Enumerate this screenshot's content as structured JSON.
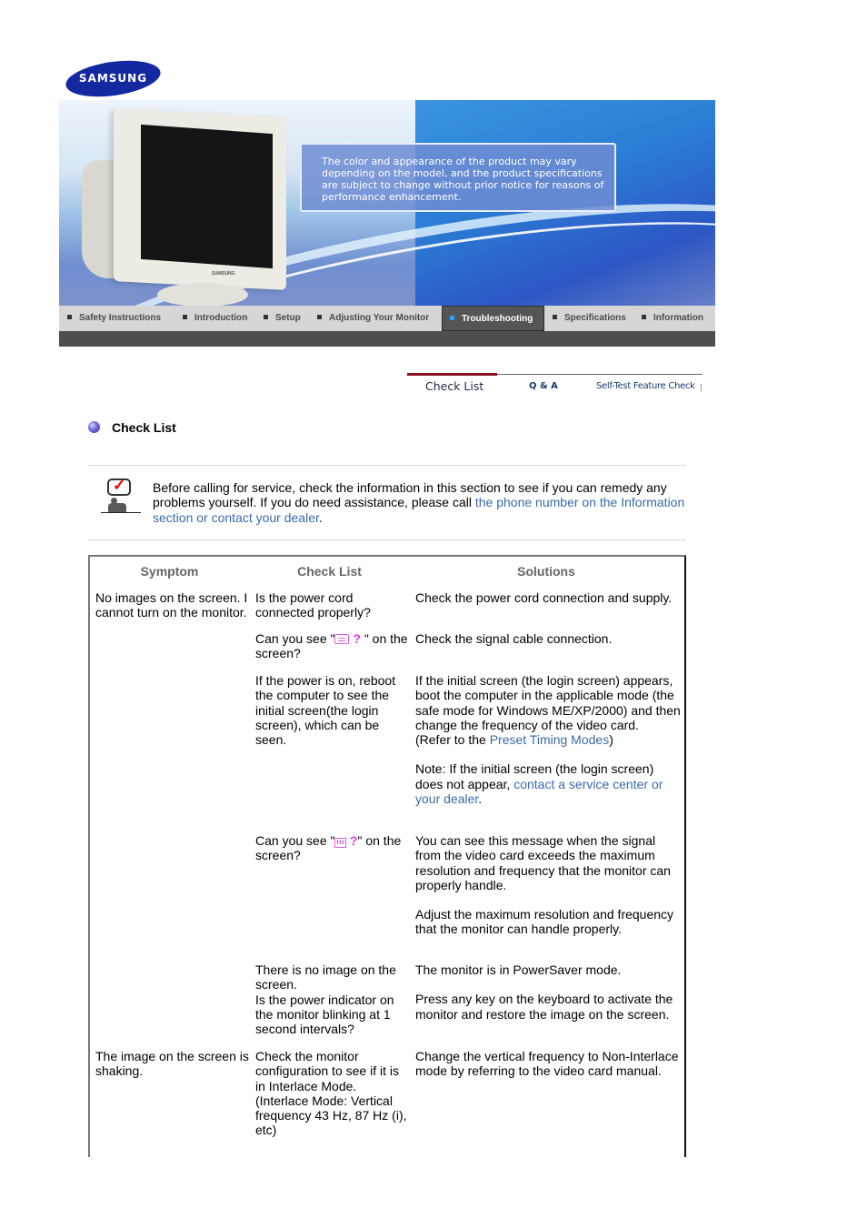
{
  "logo": {
    "text": "SAMSUNG"
  },
  "banner": {
    "notice": "The color and appearance of the product may vary depending on the model, and the product specifications are subject to change without prior notice for reasons of performance enhancement.",
    "monitor_brand": "SAMSUNG"
  },
  "nav": {
    "items": [
      {
        "label": "Safety Instructions",
        "active": false
      },
      {
        "label": "Introduction",
        "active": false
      },
      {
        "label": "Setup",
        "active": false
      },
      {
        "label": "Adjusting Your Monitor",
        "active": false
      },
      {
        "label": "Troubleshooting",
        "active": true
      },
      {
        "label": "Specifications",
        "active": false
      },
      {
        "label": "Information",
        "active": false
      }
    ],
    "active_color": "#2ba0ff"
  },
  "subtabs": {
    "items": [
      {
        "label": "Check List",
        "active": true
      },
      {
        "label": "Q & A",
        "active": false
      },
      {
        "label": "Self-Test Feature Check",
        "active": false
      }
    ],
    "active_bar_color": "#8a1020"
  },
  "section": {
    "title": "Check List"
  },
  "intro": {
    "text_before": "Before calling for service, check the information in this section to see if you can remedy any problems yourself. If you do need assistance, please call ",
    "link": "the phone number on the Information section or contact your dealer",
    "text_after": "."
  },
  "table": {
    "headers": [
      "Symptom",
      "Check List",
      "Solutions"
    ],
    "rows": [
      {
        "symptom": "No images on the screen. I cannot turn on the monitor.",
        "check": "Is the power cord connected properly?",
        "solution": "Check the power cord connection and supply."
      },
      {
        "check_before": "Can you see \"",
        "check_icon": "keyboard-icon",
        "check_glyph": "?",
        "check_after": "\" on the screen?",
        "solution": "Check the signal cable connection."
      },
      {
        "check": "If the power is on, reboot the computer to see the initial screen(the login screen), which can be seen.",
        "solution_p1": "If the initial screen (the login screen) appears, boot the computer in the applicable mode (the safe mode for Windows ME/XP/2000) and then change the frequency of the video card.",
        "solution_ref_before": "(Refer to the ",
        "solution_ref_link": "Preset Timing Modes",
        "solution_ref_after": ")",
        "solution_note_before": "Note: If the initial screen (the login screen) does not appear, ",
        "solution_note_link": "contact a service center or your dealer",
        "solution_note_after": "."
      },
      {
        "check_before": "Can you see \"",
        "check_icon_text": "Hz",
        "check_glyph": "?",
        "check_after": "\" on the screen?",
        "solution_p1": "You can see this message when the signal from the video card exceeds the maximum resolution and frequency that the monitor can properly handle.",
        "solution_p2": "Adjust the maximum resolution and frequency that the monitor can handle properly."
      },
      {
        "check": "There is no image on the screen.\nIs the power indicator on the monitor blinking at 1 second intervals?",
        "solution_p1": "The monitor is in PowerSaver mode.",
        "solution_p2": "Press any key on the keyboard to activate the monitor and restore the image on the screen."
      },
      {
        "symptom": "The image on the screen is shaking.",
        "check": "Check the monitor configuration to see if it is in Interlace Mode. (Interlace Mode: Vertical frequency 43 Hz, 87 Hz (i), etc)",
        "solution": "Change the vertical frequency to Non-Interlace mode by referring to the video card manual."
      }
    ]
  },
  "colors": {
    "link": "#3a6aa8",
    "icon_magenta": "#e040e0",
    "header_gray": "#666666"
  }
}
